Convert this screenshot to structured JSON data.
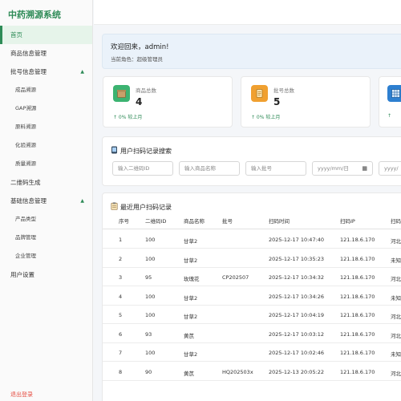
{
  "app_title": "中药溯源系统",
  "sidebar": {
    "items": [
      {
        "label": "首页"
      },
      {
        "label": "商品信息管理"
      },
      {
        "label": "批号信息管理"
      },
      {
        "label": "成品溯源"
      },
      {
        "label": "GAP溯源"
      },
      {
        "label": "原料溯源"
      },
      {
        "label": "化验溯源"
      },
      {
        "label": "质量溯源"
      },
      {
        "label": "二维码生成"
      },
      {
        "label": "基础信息管理"
      },
      {
        "label": "产品类型"
      },
      {
        "label": "品牌管理"
      },
      {
        "label": "企业管理"
      },
      {
        "label": "用户设置"
      }
    ],
    "logout": "退出登录"
  },
  "welcome": {
    "title": "欢迎回来，admin!",
    "role": "当前角色：超级管理员"
  },
  "stats": [
    {
      "label": "商品总数",
      "value": "4",
      "trend": "↑ 0% 较上月"
    },
    {
      "label": "批号总数",
      "value": "5",
      "trend": "↑ 0% 较上月"
    }
  ],
  "search": {
    "title": "用户扫码记录搜索",
    "qr_placeholder": "输入二维码ID",
    "name_placeholder": "输入商品名称",
    "batch_placeholder": "输入批号",
    "date_placeholder": "yyyy/mm/日",
    "date2_placeholder": "yyyy/"
  },
  "records": {
    "title": "最近用户扫码记录",
    "columns": [
      "序号",
      "二维码ID",
      "商品名称",
      "批号",
      "扫码时间",
      "扫码IP",
      "扫码"
    ],
    "rows": [
      [
        "1",
        "100",
        "甘草2",
        "",
        "2025-12-17 10:47:40",
        "121.18.6.170",
        "河北"
      ],
      [
        "2",
        "100",
        "甘草2",
        "",
        "2025-12-17 10:35:23",
        "121.18.6.170",
        "未知"
      ],
      [
        "3",
        "95",
        "玫瑰花",
        "CP202507",
        "2025-12-17 10:34:32",
        "121.18.6.170",
        "河北"
      ],
      [
        "4",
        "100",
        "甘草2",
        "",
        "2025-12-17 10:34:26",
        "121.18.6.170",
        "未知"
      ],
      [
        "5",
        "100",
        "甘草2",
        "",
        "2025-12-17 10:04:19",
        "121.18.6.170",
        "河北"
      ],
      [
        "6",
        "93",
        "黄芪",
        "",
        "2025-12-17 10:03:12",
        "121.18.6.170",
        "河北"
      ],
      [
        "7",
        "100",
        "甘草2",
        "",
        "2025-12-17 10:02:46",
        "121.18.6.170",
        "未知"
      ],
      [
        "8",
        "90",
        "黄芪",
        "HQ202503x",
        "2025-12-13 20:05:22",
        "121.18.6.170",
        "河北"
      ]
    ]
  },
  "colors": {
    "brand": "#2e8b57",
    "logout": "#e54d42",
    "welcome_bg": "#eaf2fa"
  }
}
